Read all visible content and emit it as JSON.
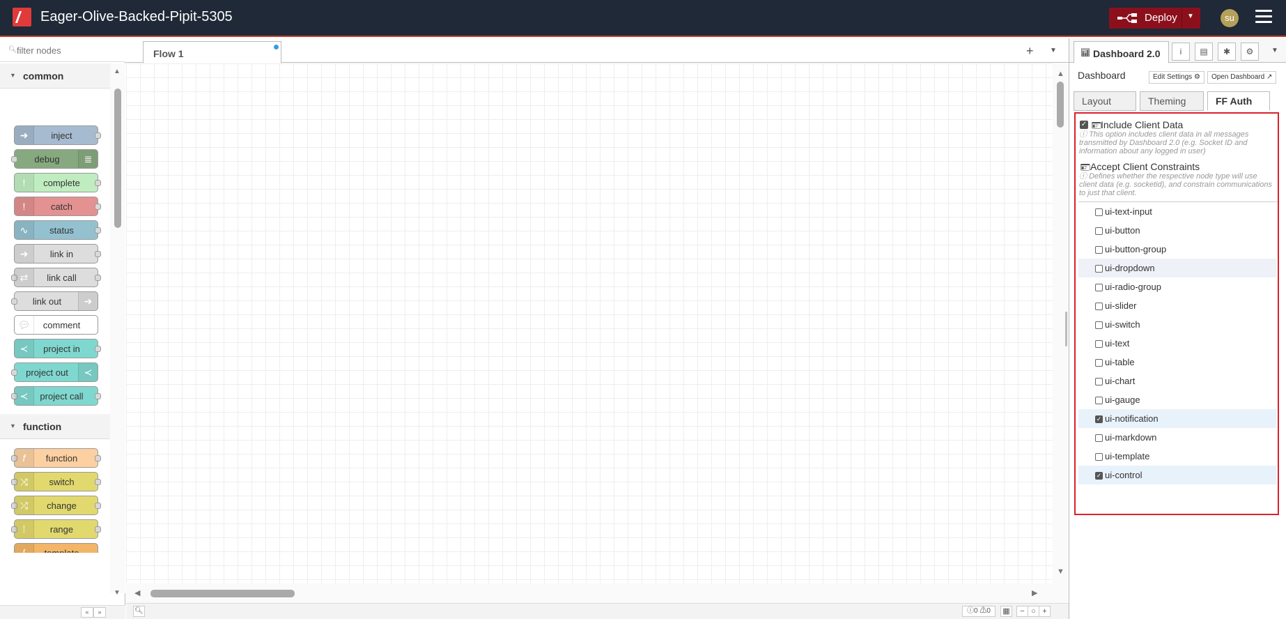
{
  "header": {
    "title": "Eager-Olive-Backed-Pipit-5305",
    "deploy_label": "Deploy",
    "avatar_initials": "su",
    "brand_color": "#e03a3a",
    "deploy_color": "#8c101c"
  },
  "palette": {
    "filter_placeholder": "filter nodes",
    "categories": [
      {
        "label": "common"
      },
      {
        "label": "function"
      }
    ],
    "nodes": [
      {
        "label": "inject",
        "color": "#a6bbcf"
      },
      {
        "label": "debug",
        "color": "#87a980"
      },
      {
        "label": "complete",
        "color": "#c0edc0"
      },
      {
        "label": "catch",
        "color": "#e49191"
      },
      {
        "label": "status",
        "color": "#94c1d0"
      },
      {
        "label": "link in",
        "color": "#dddddd"
      },
      {
        "label": "link call",
        "color": "#dddddd"
      },
      {
        "label": "link out",
        "color": "#dddddd"
      },
      {
        "label": "comment",
        "color": "#ffffff"
      },
      {
        "label": "project in",
        "color": "#7fd8cf"
      },
      {
        "label": "project out",
        "color": "#7fd8cf"
      },
      {
        "label": "project call",
        "color": "#7fd8cf"
      },
      {
        "label": "function",
        "color": "#fdd0a2"
      },
      {
        "label": "switch",
        "color": "#e2d96e"
      },
      {
        "label": "change",
        "color": "#e2d96e"
      },
      {
        "label": "range",
        "color": "#e2d96e"
      },
      {
        "label": "template",
        "color": "#f3b567"
      }
    ]
  },
  "workspace": {
    "tabs": [
      {
        "label": "Flow 1"
      }
    ],
    "status": {
      "errors": "0",
      "warnings": "0"
    }
  },
  "sidebar": {
    "active_tab": "Dashboard 2.0",
    "heading": "Dashboard",
    "edit_settings_label": "Edit Settings",
    "open_dashboard_label": "Open Dashboard",
    "sub_tabs": [
      "Layout",
      "Theming",
      "FF Auth"
    ],
    "active_sub_tab": "FF Auth",
    "include_client_data": {
      "label": "Include Client Data",
      "checked": true,
      "hint": "This option includes client data in all messages transmitted by Dashboard 2.0 (e.g. Socket ID and information about any logged in user)"
    },
    "accept_client_constraints": {
      "label": "Accept Client Constraints",
      "hint": "Defines whether the respective node type will use client data (e.g. socketid), and constrain communications to just that client."
    },
    "constraints": [
      {
        "label": "ui-text-input",
        "checked": false
      },
      {
        "label": "ui-button",
        "checked": false
      },
      {
        "label": "ui-button-group",
        "checked": false
      },
      {
        "label": "ui-dropdown",
        "checked": false
      },
      {
        "label": "ui-radio-group",
        "checked": false
      },
      {
        "label": "ui-slider",
        "checked": false
      },
      {
        "label": "ui-switch",
        "checked": false
      },
      {
        "label": "ui-text",
        "checked": false
      },
      {
        "label": "ui-table",
        "checked": false
      },
      {
        "label": "ui-chart",
        "checked": false
      },
      {
        "label": "ui-gauge",
        "checked": false
      },
      {
        "label": "ui-notification",
        "checked": true
      },
      {
        "label": "ui-markdown",
        "checked": false
      },
      {
        "label": "ui-template",
        "checked": false
      },
      {
        "label": "ui-control",
        "checked": true
      }
    ],
    "highlight_color": "#d9212c"
  }
}
